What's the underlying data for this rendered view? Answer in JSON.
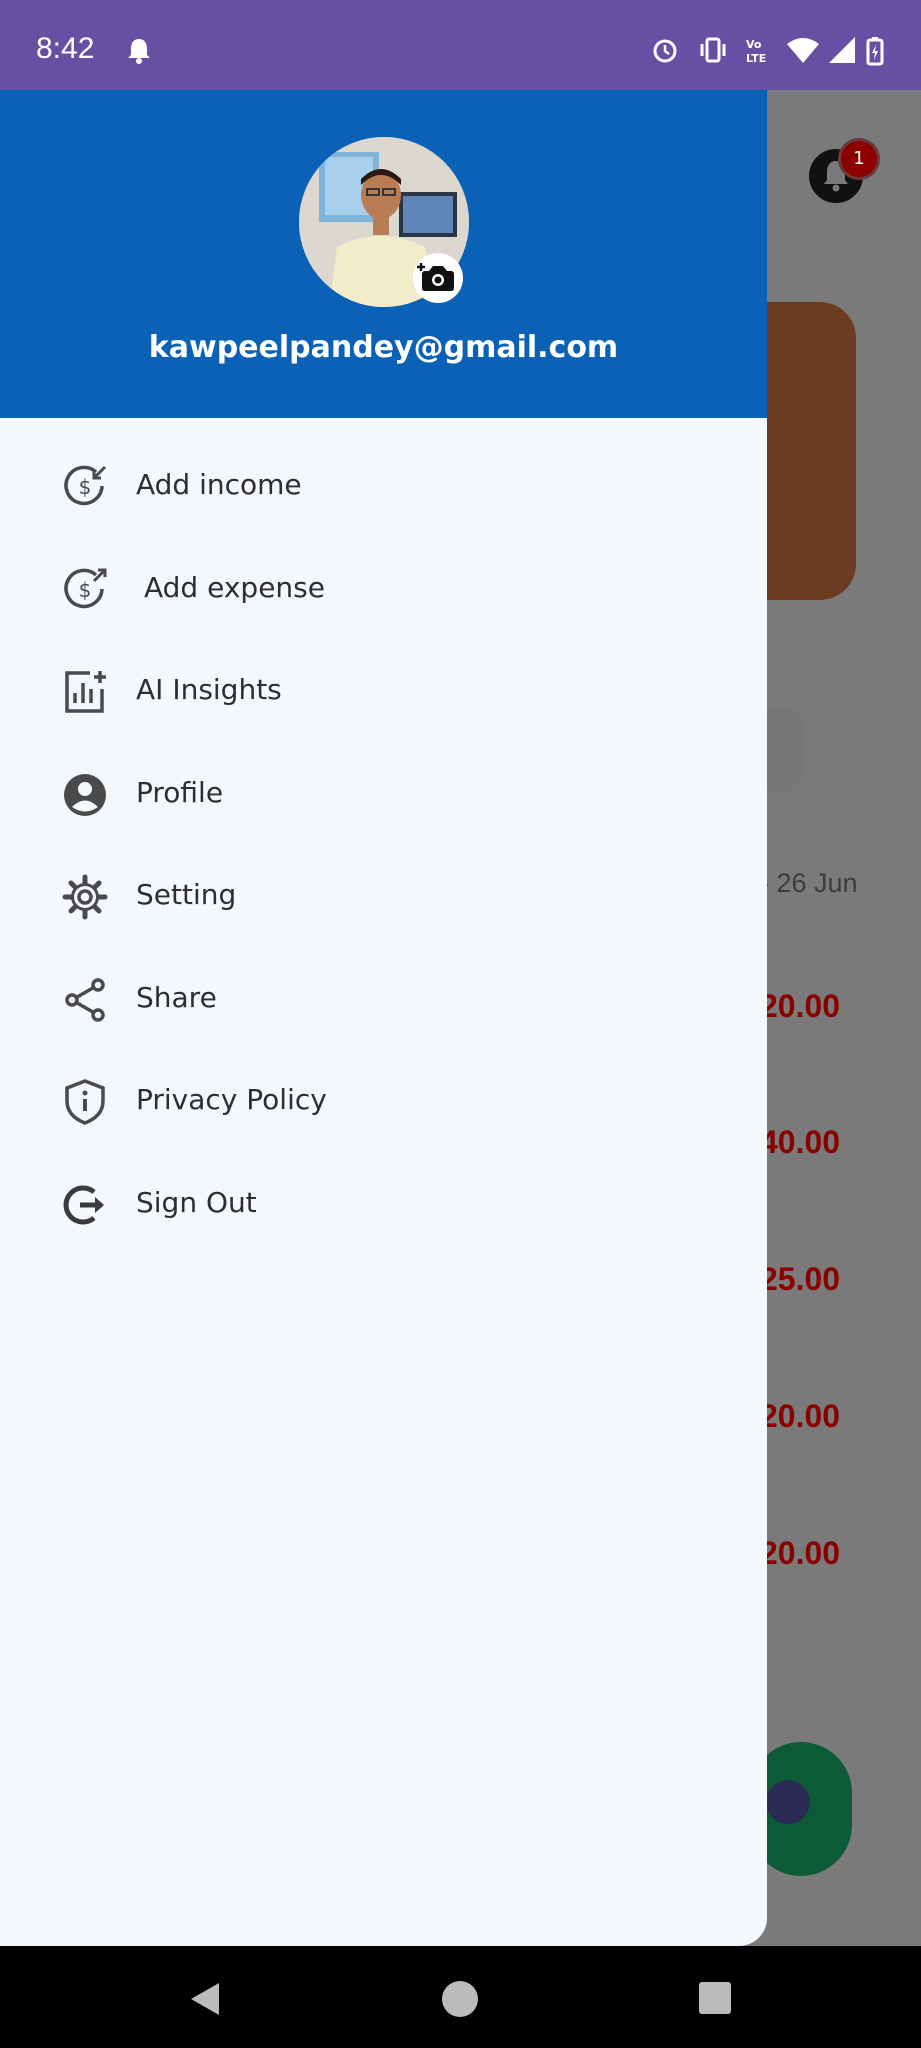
{
  "status_bar": {
    "time": "8:42"
  },
  "drawer": {
    "email": "kawpeelpandey@gmail.com",
    "menu": [
      {
        "label": "Add income",
        "icon": "add-income-icon"
      },
      {
        "label": "Add expense",
        "icon": "add-expense-icon"
      },
      {
        "label": "AI Insights",
        "icon": "insights-icon"
      },
      {
        "label": "Profile",
        "icon": "profile-icon"
      },
      {
        "label": "Setting",
        "icon": "gear-icon"
      },
      {
        "label": "Share",
        "icon": "share-icon"
      },
      {
        "label": "Privacy Policy",
        "icon": "shield-icon"
      },
      {
        "label": "Sign Out",
        "icon": "sign-out-icon"
      }
    ]
  },
  "background": {
    "notification_count": "1",
    "date_fragment": "- 26 Jun",
    "amounts": [
      "20.00",
      "40.00",
      "25.00",
      "20.00",
      "20.00"
    ]
  },
  "colors": {
    "status_bar": "#6750A4",
    "drawer_header": "#0a61b6",
    "drawer_bg": "#f4f7fc",
    "amount_red": "#8a0000"
  }
}
